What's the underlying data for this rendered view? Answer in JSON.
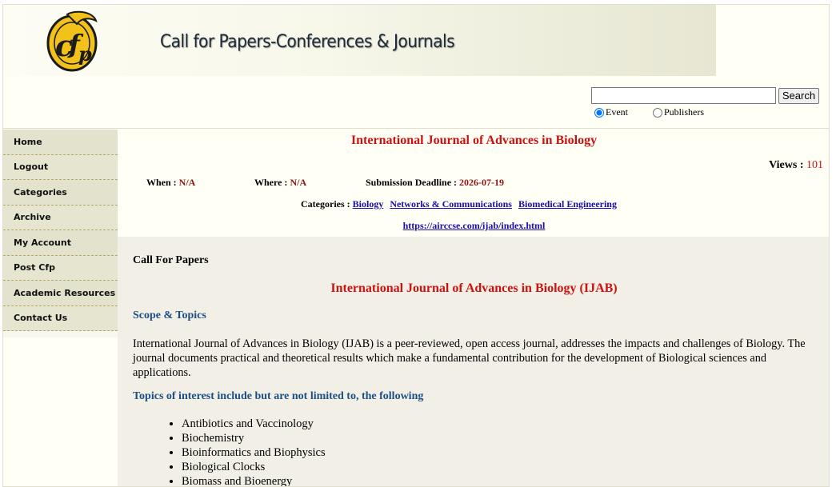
{
  "header": {
    "logo_text": "cfp",
    "site_title": "Call for Papers-Conferences & Journals",
    "search_button": "Search",
    "search_value": "",
    "radio_event": "Event",
    "radio_publishers": "Publishers"
  },
  "sidebar": {
    "items": [
      {
        "label": "Home"
      },
      {
        "label": "Logout"
      },
      {
        "label": "Categories"
      },
      {
        "label": "Archive"
      },
      {
        "label": "My Account"
      },
      {
        "label": "Post Cfp"
      },
      {
        "label": "Academic Resources"
      },
      {
        "label": "Contact Us"
      }
    ]
  },
  "event": {
    "title": "International Journal of Advances in Biology",
    "views_label": "Views :",
    "views_count": "101",
    "when_label": "When :",
    "when_value": "N/A",
    "where_label": "Where :",
    "where_value": "N/A",
    "deadline_label": "Submission Deadline :",
    "deadline_value": "2026-07-19",
    "categories_label": "Categories :",
    "categories": [
      "Biology",
      "Networks & Communications",
      "Biomedical Engineering"
    ],
    "link": "https://airccse.com/ijab/index.html"
  },
  "content": {
    "cfp_heading": "Call For Papers",
    "journal_heading": "International Journal of Advances in Biology (IJAB)",
    "scope_heading": "Scope & Topics",
    "description": "International Journal of Advances in Biology (IJAB) is a peer-reviewed, open access journal, addresses the impacts and challenges of Biology. The journal documents practical and theoretical results which make a fundamental contribution for the development of Biological sciences and applications.",
    "topics_heading": "Topics of interest include but are not limited to, the following",
    "topics": [
      "Antibiotics and Vaccinology",
      "Biochemistry",
      "Bioinformatics and Biophysics",
      "Biological Clocks",
      "Biomass and Bioenergy"
    ]
  },
  "colors": {
    "title_red": "#cc1111",
    "heading_blue": "#1c4f86",
    "link_blue": "#1a0dab",
    "logo_yellow": "#f2c21b"
  }
}
